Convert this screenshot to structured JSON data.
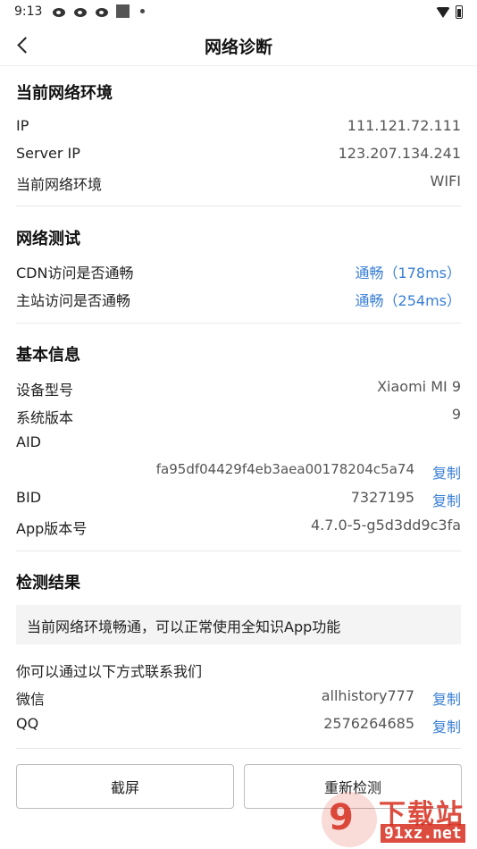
{
  "status_bar": {
    "time": "9:13"
  },
  "header": {
    "title": "网络诊断"
  },
  "env": {
    "title": "当前网络环境",
    "rows": [
      {
        "label": "IP",
        "value": "111.121.72.111"
      },
      {
        "label": "Server IP",
        "value": "123.207.134.241"
      },
      {
        "label": "当前网络环境",
        "value": "WIFI"
      }
    ]
  },
  "network_test": {
    "title": "网络测试",
    "rows": [
      {
        "label": "CDN访问是否通畅",
        "value": "通畅（178ms）"
      },
      {
        "label": "主站访问是否通畅",
        "value": "通畅（254ms）"
      }
    ]
  },
  "basic": {
    "title": "基本信息",
    "device_label": "设备型号",
    "device_value": "Xiaomi MI 9",
    "os_label": "系统版本",
    "os_value": "9",
    "aid_label": "AID",
    "aid_value": "fa95df04429f4eb3aea00178204c5a74",
    "bid_label": "BID",
    "bid_value": "7327195",
    "app_label": "App版本号",
    "app_value": "4.7.0-5-g5d3dd9c3fa",
    "copy_label": "复制"
  },
  "result": {
    "title": "检测结果",
    "notice": "当前网络环境畅通，可以正常使用全知识App功能",
    "contact_intro": "你可以通过以下方式联系我们",
    "wechat_label": "微信",
    "wechat_value": "allhistory777",
    "qq_label": "QQ",
    "qq_value": "2576264685",
    "copy_label": "复制"
  },
  "buttons": {
    "screenshot": "截屏",
    "retest": "重新检测"
  },
  "watermark": {
    "text": "下载站",
    "url": "91xz.net",
    "logo": "9"
  },
  "colors": {
    "link": "#3a7fd5",
    "divider": "#e8e8e8",
    "notice_bg": "#f4f4f4"
  }
}
